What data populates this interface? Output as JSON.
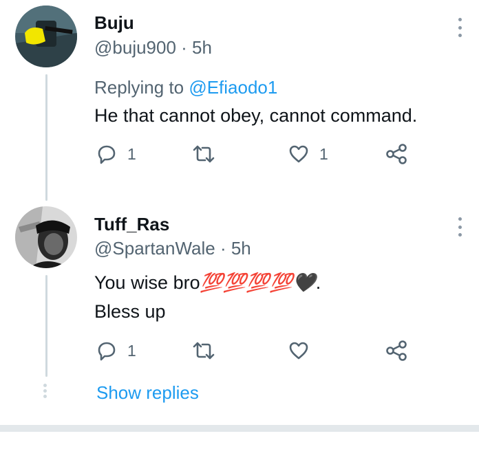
{
  "tweets": [
    {
      "name": "Buju",
      "meta": "@buju900 · 5h",
      "replying_label": "Replying to ",
      "replying_handle": "@Efiaodo1",
      "text_lines": [
        "He that cannot obey, cannot command."
      ],
      "reply_count": "1",
      "retweet_count": "",
      "like_count": "1",
      "avatar": "yellow-object-photo"
    },
    {
      "name": "Tuff_Ras",
      "meta": "@SpartanWale · 5h",
      "text_line1": "You wise bro",
      "text_emoji": "💯💯💯💯🖤",
      "text_period": ".",
      "text_line2": "Bless up",
      "reply_count": "1",
      "retweet_count": "",
      "like_count": "",
      "avatar": "grayscale-portrait-photo"
    }
  ],
  "show_replies_label": "Show replies",
  "colors": {
    "accent": "#1d9bf0",
    "text": "#0f1419",
    "muted": "#536471",
    "line": "#cfd9de"
  }
}
